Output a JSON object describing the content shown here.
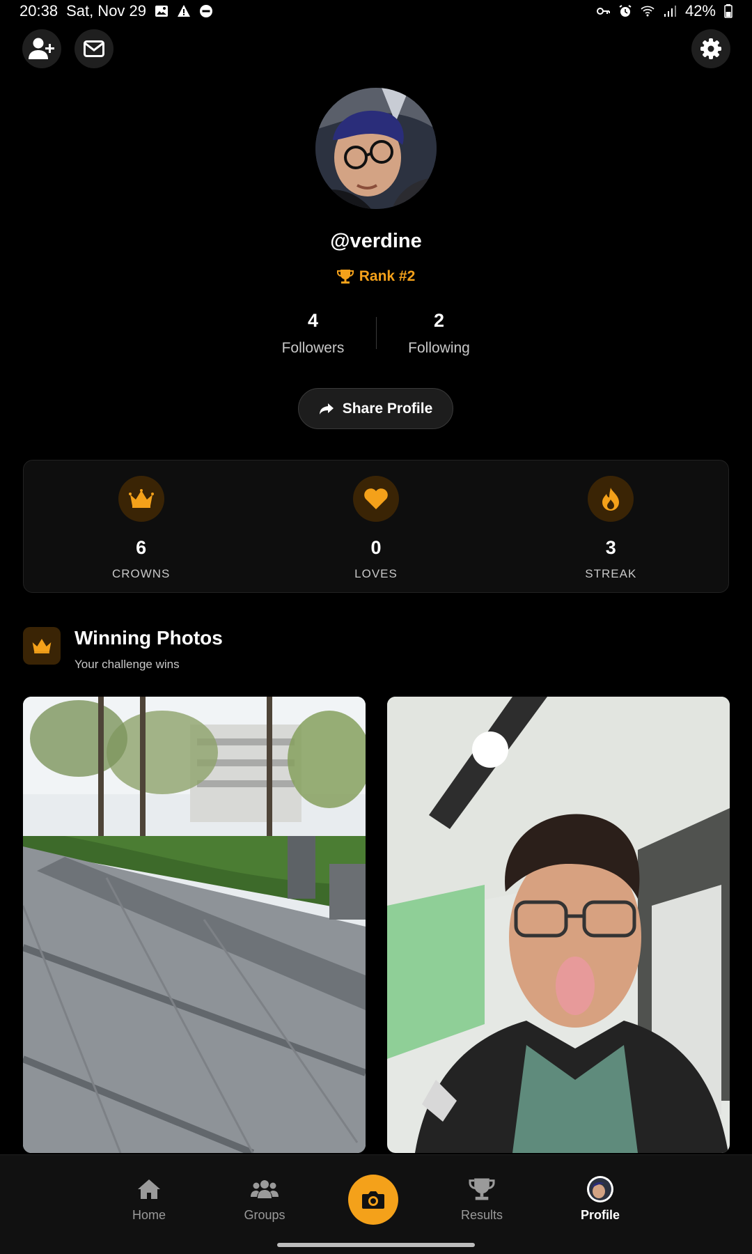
{
  "status_bar": {
    "time": "20:38",
    "date": "Sat, Nov 29",
    "battery": "42%",
    "left_icons": [
      "image-icon",
      "warning-icon",
      "dnd-icon"
    ],
    "right_icons": [
      "key-icon",
      "alarm-icon",
      "wifi-icon",
      "signal-icon",
      "battery-icon"
    ]
  },
  "header": {
    "add_friend_icon": "person-add-icon",
    "inbox_icon": "envelope-icon",
    "settings_icon": "gear-icon"
  },
  "profile": {
    "username": "@verdine",
    "rank": "Rank #2",
    "followers_count": "4",
    "followers_label": "Followers",
    "following_count": "2",
    "following_label": "Following",
    "share_label": "Share Profile"
  },
  "stats": [
    {
      "icon": "crown-icon",
      "value": "6",
      "label": "CROWNS"
    },
    {
      "icon": "heart-icon",
      "value": "0",
      "label": "LOVES"
    },
    {
      "icon": "flame-icon",
      "value": "3",
      "label": "STREAK"
    }
  ],
  "winning": {
    "title": "Winning Photos",
    "subtitle": "Your challenge wins",
    "photos": [
      "street-photo",
      "selfie-photo"
    ]
  },
  "nav": {
    "items": [
      {
        "label": "Home",
        "icon": "home-icon"
      },
      {
        "label": "Groups",
        "icon": "users-icon"
      },
      {
        "label": "",
        "icon": "camera-icon"
      },
      {
        "label": "Results",
        "icon": "trophy-icon"
      },
      {
        "label": "Profile",
        "icon": "avatar-icon"
      }
    ],
    "active": "Profile"
  },
  "colors": {
    "accent": "#f4a11a",
    "background": "#000000",
    "card": "#0e0e0e",
    "icon_bg": "#3a2405"
  }
}
